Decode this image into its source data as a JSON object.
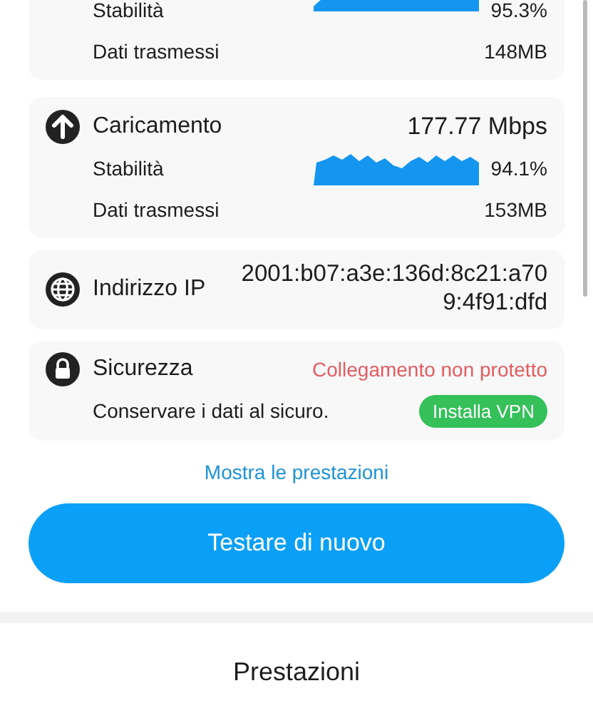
{
  "cards": [
    {
      "kind": "speed",
      "stability_label": "Stabilità",
      "stability": "95.3%",
      "data_label": "Dati trasmessi",
      "data": "148MB"
    },
    {
      "kind": "speed",
      "title": "Caricamento",
      "value": "177.77 Mbps",
      "stability_label": "Stabilità",
      "stability": "94.1%",
      "data_label": "Dati trasmessi",
      "data": "153MB"
    },
    {
      "kind": "ip",
      "title": "Indirizzo IP",
      "value": "2001:b07:a3e:136d:8c21:a709:4f91:dfd"
    },
    {
      "kind": "security",
      "title": "Sicurezza",
      "status": "Collegamento non protetto",
      "note": "Conservare i dati al sicuro.",
      "action": "Installa VPN"
    }
  ],
  "link": "Mostra le prestazioni",
  "button": "Testare di nuovo",
  "section_title": "Prestazioni"
}
